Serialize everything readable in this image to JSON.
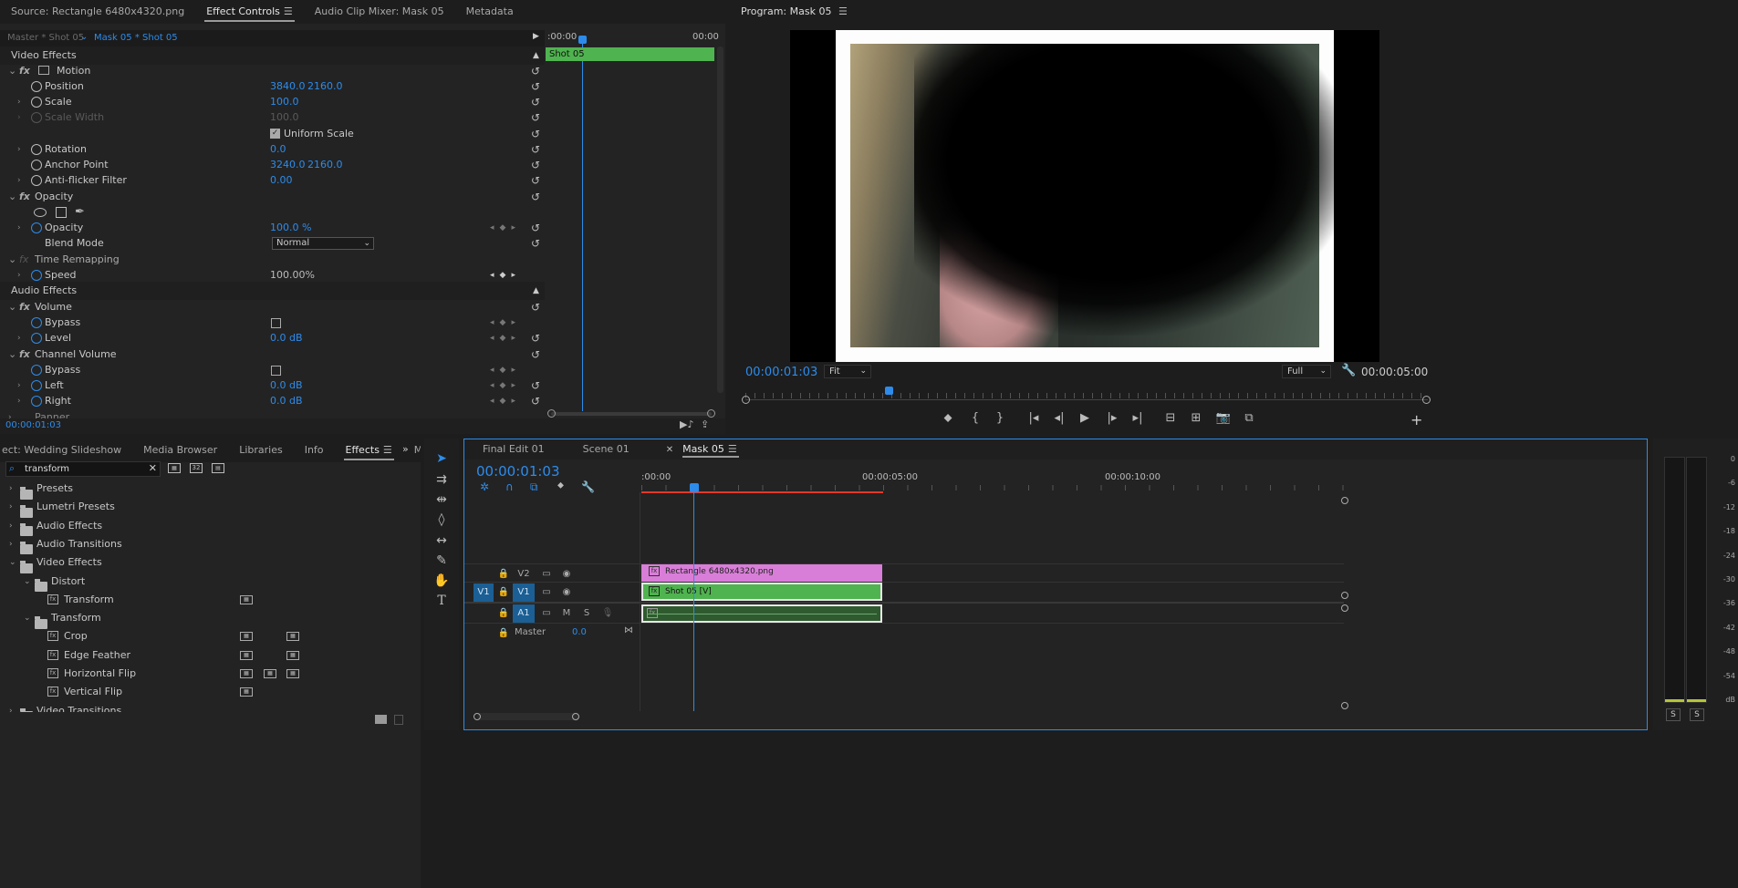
{
  "source_panel": {
    "tabs": [
      {
        "label": "Source: Rectangle 6480x4320.png",
        "active": false
      },
      {
        "label": "Effect Controls",
        "active": true
      },
      {
        "label": "Audio Clip Mixer: Mask 05",
        "active": false
      },
      {
        "label": "Metadata",
        "active": false
      }
    ],
    "master_label": "Master * Shot 05",
    "clip_label": "Mask 05 * Shot 05",
    "mini_timeline": {
      "start": ":00:00",
      "end": "00:00",
      "clip": "Shot 05"
    },
    "video_effects_header": "Video Effects",
    "audio_effects_header": "Audio Effects",
    "motion": "Motion",
    "position_label": "Position",
    "position_x": "3840.0",
    "position_y": "2160.0",
    "scale_label": "Scale",
    "scale_val": "100.0",
    "scale_width_label": "Scale Width",
    "scale_width_val": "100.0",
    "uniform_scale": "Uniform Scale",
    "rotation_label": "Rotation",
    "rotation_val": "0.0",
    "anchor_label": "Anchor Point",
    "anchor_x": "3240.0",
    "anchor_y": "2160.0",
    "antiflicker_label": "Anti-flicker Filter",
    "antiflicker_val": "0.00",
    "opacity_group": "Opacity",
    "opacity_label": "Opacity",
    "opacity_val": "100.0 %",
    "blend_label": "Blend Mode",
    "blend_val": "Normal",
    "time_remap": "Time Remapping",
    "speed_label": "Speed",
    "speed_val": "100.00%",
    "volume": "Volume",
    "bypass_label": "Bypass",
    "level_label": "Level",
    "level_val": "0.0 dB",
    "channel_volume": "Channel Volume",
    "left_label": "Left",
    "left_val": "0.0 dB",
    "right_label": "Right",
    "right_val": "0.0 dB",
    "panner": "Panner",
    "timecode": "00:00:01:03"
  },
  "program": {
    "title": "Program: Mask 05",
    "timecode": "00:00:01:03",
    "fit": "Fit",
    "full": "Full",
    "duration": "00:00:05:00",
    "playhead_fraction": 0.21
  },
  "project": {
    "tabs": [
      {
        "label": "ect: Wedding Slideshow",
        "active": false
      },
      {
        "label": "Media Browser",
        "active": false
      },
      {
        "label": "Libraries",
        "active": false
      },
      {
        "label": "Info",
        "active": false
      },
      {
        "label": "Effects",
        "active": true
      },
      {
        "label": "Mar",
        "active": false
      }
    ],
    "search": "transform",
    "tree": [
      {
        "label": "Presets",
        "level": 0,
        "type": "folder",
        "open": false
      },
      {
        "label": "Lumetri Presets",
        "level": 0,
        "type": "folder",
        "open": false
      },
      {
        "label": "Audio Effects",
        "level": 0,
        "type": "folder",
        "open": false
      },
      {
        "label": "Audio Transitions",
        "level": 0,
        "type": "folder",
        "open": false
      },
      {
        "label": "Video Effects",
        "level": 0,
        "type": "folder",
        "open": true
      },
      {
        "label": "Distort",
        "level": 1,
        "type": "folder",
        "open": true
      },
      {
        "label": "Transform",
        "level": 2,
        "type": "effect",
        "b1": true,
        "b2": false,
        "b3": false
      },
      {
        "label": "Transform",
        "level": 1,
        "type": "folder",
        "open": true
      },
      {
        "label": "Crop",
        "level": 2,
        "type": "effect",
        "b1": true,
        "b2": false,
        "b3": true
      },
      {
        "label": "Edge Feather",
        "level": 2,
        "type": "effect",
        "b1": true,
        "b2": false,
        "b3": true
      },
      {
        "label": "Horizontal Flip",
        "level": 2,
        "type": "effect",
        "b1": true,
        "b2": true,
        "b3": true
      },
      {
        "label": "Vertical Flip",
        "level": 2,
        "type": "effect",
        "b1": true,
        "b2": false,
        "b3": false
      },
      {
        "label": "Video Transitions",
        "level": 0,
        "type": "folder",
        "open": false
      }
    ]
  },
  "timeline": {
    "tabs": [
      {
        "label": "Final Edit 01",
        "active": false
      },
      {
        "label": "Scene 01",
        "active": false
      },
      {
        "label": "Mask 05",
        "active": true
      }
    ],
    "timecode": "00:00:01:03",
    "ruler": [
      ":00:00",
      "00:00:05:00",
      "00:00:10:00"
    ],
    "tracks": {
      "v2": "V2",
      "v1": "V1",
      "v1src": "V1",
      "a1": "A1",
      "m": "M",
      "s": "S",
      "master": "Master",
      "master_val": "0.0"
    },
    "clips": {
      "v2": "Rectangle 6480x4320.png",
      "v1": "Shot 05 [V]"
    }
  },
  "meter": {
    "ticks": [
      "0",
      "-6",
      "-12",
      "-18",
      "-24",
      "-30",
      "-36",
      "-42",
      "-48",
      "-54",
      "dB"
    ],
    "solo": [
      "S",
      "S"
    ]
  },
  "colors": {
    "accent": "#2d8ceb",
    "clip_green": "#4fb34f",
    "clip_pink": "#d97ed8",
    "audio_green": "#2f5a2f"
  }
}
